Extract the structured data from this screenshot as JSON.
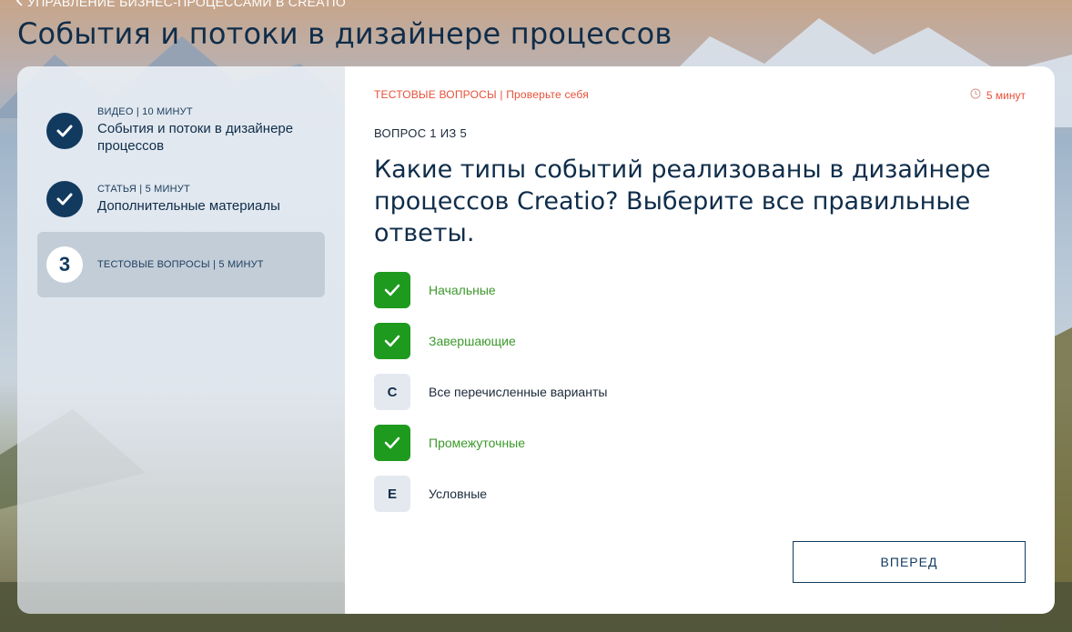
{
  "header": {
    "breadcrumb": "УПРАВЛЕНИЕ БИЗНЕС-ПРОЦЕССАМИ В CREATIO",
    "title": "События и потоки в дизайнере процессов"
  },
  "sidebar": {
    "steps": [
      {
        "meta": "ВИДЕО | 10 МИНУТ",
        "title": "События и потоки в дизайнере процессов",
        "status": "done",
        "icon": "check-icon"
      },
      {
        "meta": "СТАТЬЯ | 5 МИНУТ",
        "title": "Дополнительные материалы",
        "status": "done",
        "icon": "check-icon"
      },
      {
        "meta": "ТЕСТОВЫЕ ВОПРОСЫ | 5 МИНУТ",
        "number": "3",
        "status": "active"
      }
    ]
  },
  "quiz": {
    "section_label": "ТЕСТОВЫЕ ВОПРОСЫ | Проверьте себя",
    "timer": "5 минут",
    "timer_icon": "clock-icon",
    "counter": "ВОПРОС 1 ИЗ 5",
    "question": "Какие типы событий реализованы в дизайнере процессов Creatio? Выберите все правильные ответы.",
    "options": [
      {
        "letter": "",
        "label": "Начальные",
        "checked": true
      },
      {
        "letter": "",
        "label": "Завершающие",
        "checked": true
      },
      {
        "letter": "C",
        "label": "Все перечисленные варианты",
        "checked": false
      },
      {
        "letter": "",
        "label": "Промежуточные",
        "checked": true
      },
      {
        "letter": "E",
        "label": "Условные",
        "checked": false
      }
    ],
    "next_label": "ВПЕРЕД"
  },
  "colors": {
    "accent": "#e8503a",
    "navy": "#123a5f",
    "correct": "#1e9a1e"
  }
}
